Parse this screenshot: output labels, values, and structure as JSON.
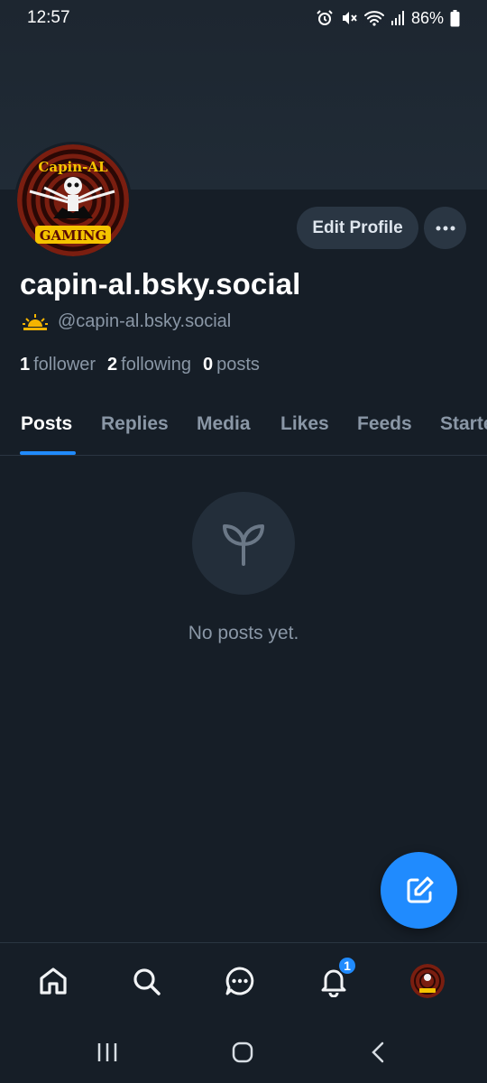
{
  "status_bar": {
    "time": "12:57",
    "battery": "86%"
  },
  "profile": {
    "display_name": "capin-al.bsky.social",
    "handle": "@capin-al.bsky.social",
    "avatar_text_top": "Capin-AL",
    "avatar_text_bottom": "GAMING"
  },
  "actions": {
    "edit_profile": "Edit Profile"
  },
  "stats": {
    "followers_count": "1",
    "followers_label": "follower",
    "following_count": "2",
    "following_label": "following",
    "posts_count": "0",
    "posts_label": "posts"
  },
  "tabs": [
    "Posts",
    "Replies",
    "Media",
    "Likes",
    "Feeds",
    "Starter Packs"
  ],
  "active_tab": "Posts",
  "empty_state": {
    "text": "No posts yet.",
    "icon": "sprout-icon"
  },
  "bottom_nav": {
    "items": [
      "home-icon",
      "search-icon",
      "chat-icon",
      "bell-icon",
      "avatar"
    ],
    "notifications_badge": "1"
  },
  "colors": {
    "background": "#161e27",
    "accent": "#208bfe",
    "muted": "#8a97a6"
  }
}
